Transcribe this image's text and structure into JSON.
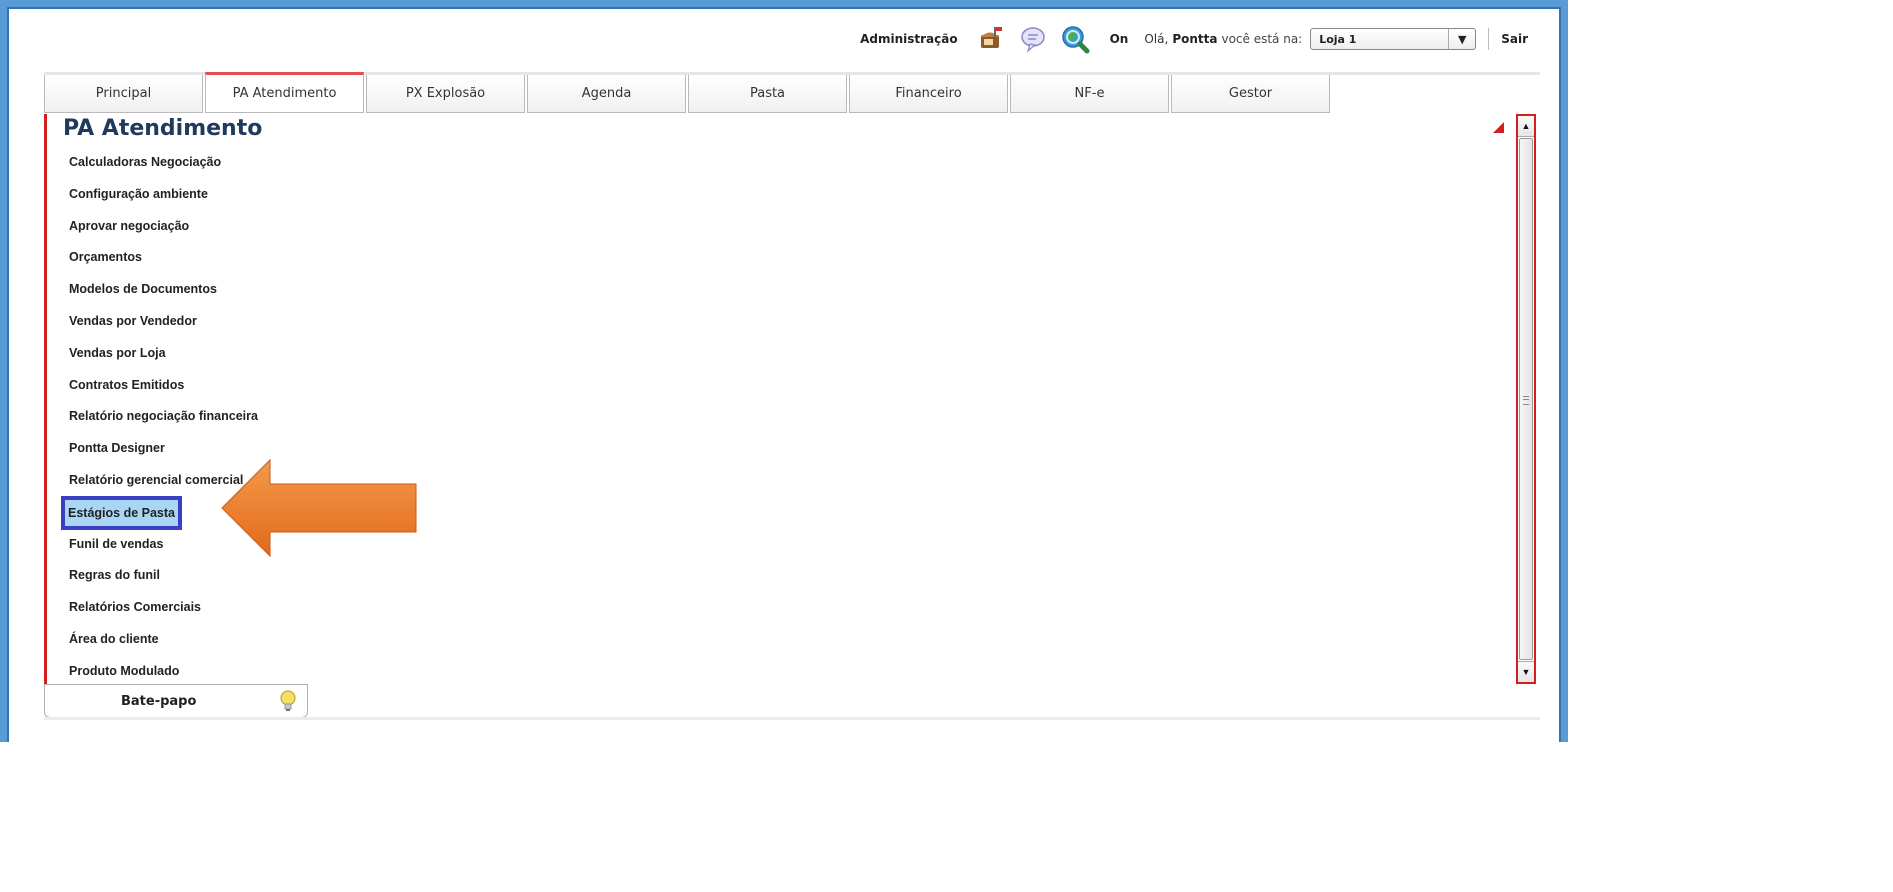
{
  "header": {
    "admin_label": "Administração",
    "status": "On",
    "greeting": "Olá,",
    "user_name": "Pontta",
    "location_text": "você está na:",
    "store_select": {
      "value": "Loja 1"
    },
    "logout_label": "Sair",
    "icons": [
      "mailbox-icon",
      "chat-bubble-icon",
      "search-globe-icon"
    ]
  },
  "tabs": [
    {
      "label": "Principal",
      "active": false
    },
    {
      "label": "PA Atendimento",
      "active": true
    },
    {
      "label": "PX Explosão",
      "active": false
    },
    {
      "label": "Agenda",
      "active": false
    },
    {
      "label": "Pasta",
      "active": false
    },
    {
      "label": "Financeiro",
      "active": false
    },
    {
      "label": "NF-e",
      "active": false
    },
    {
      "label": "Gestor",
      "active": false
    }
  ],
  "panel": {
    "title": "PA Atendimento",
    "items": [
      "Calculadoras Negociação",
      "Configuração ambiente",
      "Aprovar negociação",
      "Orçamentos",
      "Modelos de Documentos",
      "Vendas por Vendedor",
      "Vendas por Loja",
      "Contratos Emitidos",
      "Relatório negociação financeira",
      "Pontta Designer",
      "Relatório gerencial comercial",
      "Estágios de Pasta",
      "Funil de vendas",
      "Regras do funil",
      "Relatórios Comerciais",
      "Área do cliente",
      "Produto Modulado"
    ],
    "highlighted_item": "Estágios de Pasta"
  },
  "chat": {
    "label": "Bate-papo",
    "icon": "lightbulb-icon"
  },
  "colors": {
    "frame": "#5b9bd5",
    "accent_red": "#d22020",
    "highlight_bg": "#a9d6f5",
    "highlight_border": "#3b3fc4",
    "arrow": "#f07f2c"
  }
}
